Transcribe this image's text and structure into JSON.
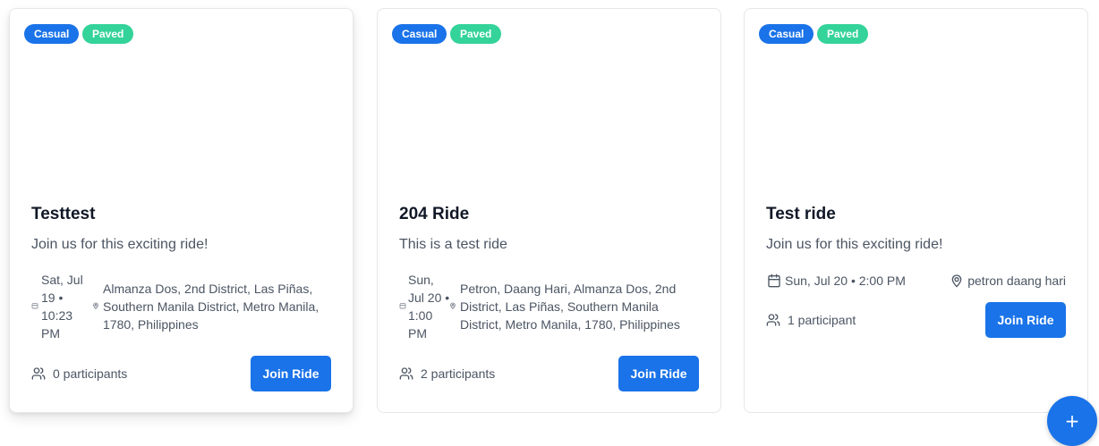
{
  "rides": [
    {
      "tags": [
        "Casual",
        "Paved"
      ],
      "title": "Testtest",
      "description": "Join us for this exciting ride!",
      "datetime": "Sat, Jul 19 • 10:23 PM",
      "location": "Almanza Dos, 2nd District, Las Piñas, Southern Manila District, Metro Manila, 1780, Philippines",
      "participants": "0 participants",
      "join_label": "Join Ride",
      "datetime_icon": "calendar-icon",
      "location_icon": "map-pin-icon",
      "participants_icon": "users-icon"
    },
    {
      "tags": [
        "Casual",
        "Paved"
      ],
      "title": "204 Ride",
      "description": "This is a test ride",
      "datetime": "Sun, Jul 20 • 1:00 PM",
      "location": "Petron, Daang Hari, Almanza Dos, 2nd District, Las Piñas, Southern Manila District, Metro Manila, 1780, Philippines",
      "participants": "2 participants",
      "join_label": "Join Ride",
      "datetime_icon": "calendar-icon",
      "location_icon": "map-pin-icon",
      "participants_icon": "users-icon"
    },
    {
      "tags": [
        "Casual",
        "Paved"
      ],
      "title": "Test ride",
      "description": "Join us for this exciting ride!",
      "datetime": "Sun, Jul 20 • 2:00 PM",
      "location": "petron daang hari",
      "participants": "1 participant",
      "join_label": "Join Ride",
      "datetime_icon": "calendar-icon",
      "location_icon": "map-pin-icon",
      "participants_icon": "users-icon"
    }
  ],
  "fab": {
    "label": "+",
    "icon": "plus-icon"
  },
  "colors": {
    "primary": "#1a73e8",
    "tag_casual": "#1a73e8",
    "tag_paved": "#34d399",
    "text_muted": "#4b5563",
    "card_border": "#e5e7eb"
  }
}
